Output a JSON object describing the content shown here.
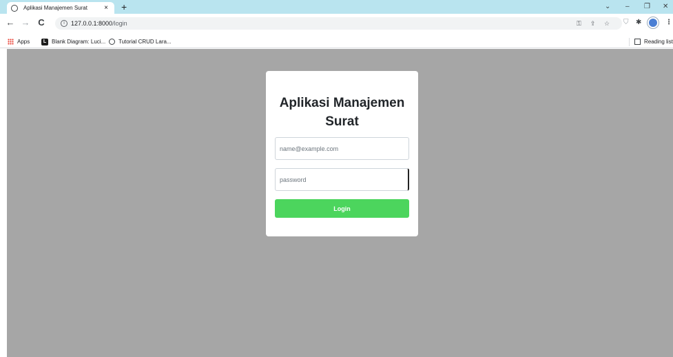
{
  "browser": {
    "tab": {
      "title": "Aplikasi Manajemen Surat",
      "close": "×"
    },
    "new_tab": "+",
    "window_controls": {
      "minimize": "–",
      "restore": "❐",
      "close": "✕",
      "dropdown": "⌄"
    },
    "nav": {
      "back": "←",
      "forward": "→",
      "reload": "C"
    },
    "address": {
      "host": "127.0.0.1:8000",
      "path": "/login"
    },
    "bookmarks": [
      {
        "label": "Apps",
        "icon": "apps-grid-icon"
      },
      {
        "label": "Blank Diagram: Luci...",
        "icon": "lucid-icon"
      },
      {
        "label": "Tutorial CRUD Lara...",
        "icon": "globe-icon"
      }
    ],
    "reading_list": "Reading list"
  },
  "page": {
    "title": "Aplikasi Manajemen Surat",
    "email_placeholder": "name@example.com",
    "password_placeholder": "password",
    "login_label": "Login",
    "colors": {
      "background": "#a6a6a6",
      "button": "#4cd55d"
    }
  }
}
